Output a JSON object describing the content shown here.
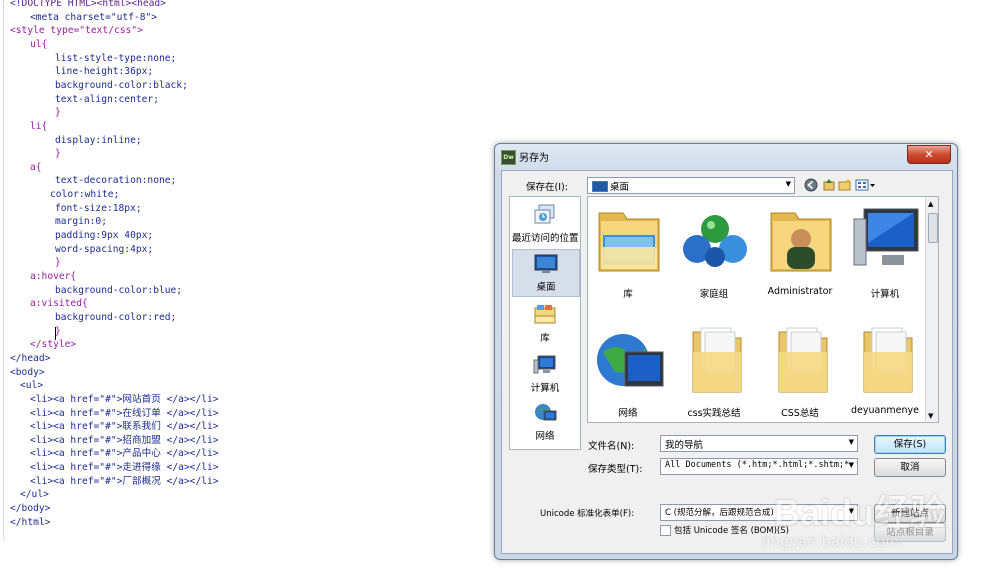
{
  "editor": {
    "lines": [
      {
        "text": "<!DOCTYPE HTML><html><head>",
        "indent": 1,
        "color": "#5a1e8e"
      },
      {
        "text": "<meta charset=\"utf-8\">",
        "indent": 5,
        "color": "#1e2c8e"
      },
      {
        "text": "<style type=\"text/css\">",
        "indent": 1,
        "color": "#9a1ea0"
      },
      {
        "text": "ul{",
        "indent": 5,
        "color": "#9a1ea0"
      },
      {
        "text": "list-style-type:none;",
        "indent": 10,
        "color": "#1e2c8e"
      },
      {
        "text": "line-height:36px;",
        "indent": 10,
        "color": "#1e2c8e"
      },
      {
        "text": "background-color:black;",
        "indent": 10,
        "color": "#1e2c8e"
      },
      {
        "text": "text-align:center;",
        "indent": 10,
        "color": "#1e2c8e"
      },
      {
        "text": "}",
        "indent": 10,
        "color": "#9a1ea0"
      },
      {
        "text": "li{",
        "indent": 5,
        "color": "#9a1ea0"
      },
      {
        "text": "display:inline;",
        "indent": 10,
        "color": "#1e2c8e"
      },
      {
        "text": "}",
        "indent": 10,
        "color": "#9a1ea0"
      },
      {
        "text": "a{",
        "indent": 5,
        "color": "#9a1ea0"
      },
      {
        "text": "text-decoration:none;",
        "indent": 10,
        "color": "#1e2c8e"
      },
      {
        "text": "color:white;",
        "indent": 9,
        "color": "#1e2c8e"
      },
      {
        "text": "font-size:18px;",
        "indent": 10,
        "color": "#1e2c8e"
      },
      {
        "text": "margin:0;",
        "indent": 10,
        "color": "#1e2c8e"
      },
      {
        "text": "padding:9px 40px;",
        "indent": 10,
        "color": "#1e2c8e"
      },
      {
        "text": "word-spacing:4px;",
        "indent": 10,
        "color": "#1e2c8e"
      },
      {
        "text": "}",
        "indent": 10,
        "color": "#9a1ea0"
      },
      {
        "text": "a:hover{",
        "indent": 5,
        "color": "#9a1ea0"
      },
      {
        "text": "background-color:blue;",
        "indent": 10,
        "color": "#1e2c8e"
      },
      {
        "text": "a:visited{",
        "indent": 5,
        "color": "#9a1ea0"
      },
      {
        "text": "background-color:red;",
        "indent": 10,
        "color": "#1e2c8e"
      },
      {
        "text": "}",
        "indent": 10,
        "color": "#9a1ea0"
      },
      {
        "text": "</style>",
        "indent": 5,
        "color": "#9a1ea0"
      },
      {
        "text": "</head>",
        "indent": 1,
        "color": "#1e2c8e"
      },
      {
        "text": "<body>",
        "indent": 1,
        "color": "#1e2c8e"
      },
      {
        "text": "<ul>",
        "indent": 3,
        "color": "#1e2c8e"
      },
      {
        "text": "<li><a href=\"#\">网站首页 </a></li>",
        "indent": 5,
        "color": "#1e2c8e"
      },
      {
        "text": "<li><a href=\"#\">在线订单 </a></li>",
        "indent": 5,
        "color": "#1e2c8e"
      },
      {
        "text": "<li><a href=\"#\">联系我们 </a></li>",
        "indent": 5,
        "color": "#1e2c8e"
      },
      {
        "text": "<li><a href=\"#\">招商加盟 </a></li>",
        "indent": 5,
        "color": "#1e2c8e"
      },
      {
        "text": "<li><a href=\"#\">产品中心 </a></li>",
        "indent": 5,
        "color": "#1e2c8e"
      },
      {
        "text": "<li><a href=\"#\">走进得缘 </a></li>",
        "indent": 5,
        "color": "#1e2c8e"
      },
      {
        "text": "<li><a href=\"#\">厂部概况 </a></li>",
        "indent": 5,
        "color": "#1e2c8e"
      },
      {
        "text": "</ul>",
        "indent": 3,
        "color": "#1e2c8e"
      },
      {
        "text": "</body>",
        "indent": 1,
        "color": "#1e2c8e"
      },
      {
        "text": "</html>",
        "indent": 1,
        "color": "#1e2c8e"
      }
    ]
  },
  "dialog": {
    "app_icon": "Dw",
    "title": "另存为",
    "close_glyph": "✕",
    "save_in_label": "保存在(I):",
    "save_in_value": "桌面",
    "places": [
      {
        "label": "最近访问的位置",
        "icon": "recent-places-icon"
      },
      {
        "label": "桌面",
        "icon": "desktop-icon"
      },
      {
        "label": "库",
        "icon": "library-icon"
      },
      {
        "label": "计算机",
        "icon": "computer-icon"
      },
      {
        "label": "网络",
        "icon": "network-icon"
      }
    ],
    "files": [
      {
        "label": "库",
        "icon": "library-folder-icon"
      },
      {
        "label": "家庭组",
        "icon": "homegroup-icon"
      },
      {
        "label": "Administrator",
        "icon": "user-folder-icon"
      },
      {
        "label": "计算机",
        "icon": "computer-icon"
      },
      {
        "label": "网络",
        "icon": "network-icon"
      },
      {
        "label": "css实践总结",
        "icon": "folder-icon"
      },
      {
        "label": "CSS总结",
        "icon": "folder-icon"
      },
      {
        "label": "deyuanmenye",
        "icon": "folder-icon"
      }
    ],
    "filename_label": "文件名(N):",
    "filename_value": "我的导航",
    "filetype_label": "保存类型(T):",
    "filetype_value": "All Documents (*.htm;*.html;*.shtm;*.",
    "save_button": "保存(S)",
    "cancel_button": "取消",
    "unicode_label": "Unicode 标准化表单(F):",
    "unicode_value": "C (规范分解，后跟规范合成)",
    "new_site_button": "新建站点",
    "bom_checkbox_label": "包括 Unicode 签名 (BOM)(S)",
    "site_root_button": "站点根目录"
  },
  "watermark": {
    "logo": "Baidu经验",
    "url": "jingyan.baidu.com"
  }
}
